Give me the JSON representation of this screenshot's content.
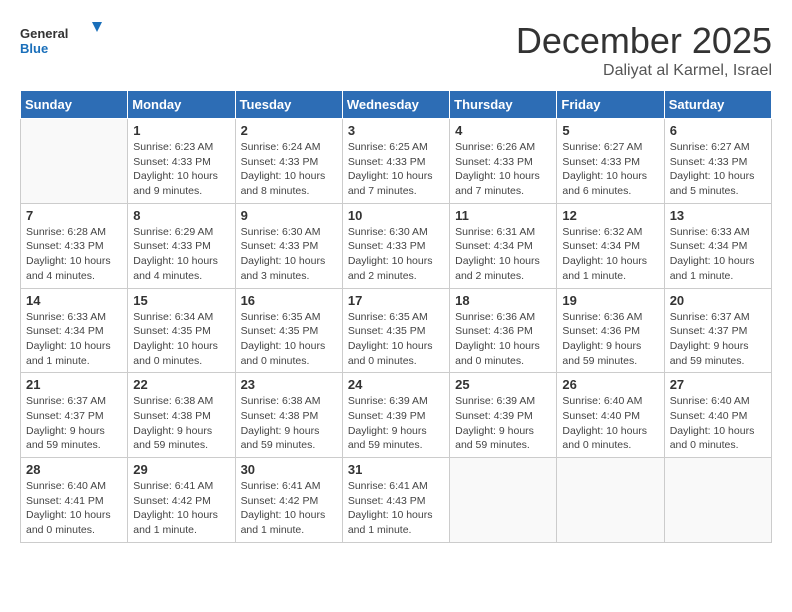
{
  "header": {
    "logo_general": "General",
    "logo_blue": "Blue",
    "month_title": "December 2025",
    "subtitle": "Daliyat al Karmel, Israel"
  },
  "calendar": {
    "days_of_week": [
      "Sunday",
      "Monday",
      "Tuesday",
      "Wednesday",
      "Thursday",
      "Friday",
      "Saturday"
    ],
    "weeks": [
      [
        {
          "day": "",
          "info": ""
        },
        {
          "day": "1",
          "info": "Sunrise: 6:23 AM\nSunset: 4:33 PM\nDaylight: 10 hours\nand 9 minutes."
        },
        {
          "day": "2",
          "info": "Sunrise: 6:24 AM\nSunset: 4:33 PM\nDaylight: 10 hours\nand 8 minutes."
        },
        {
          "day": "3",
          "info": "Sunrise: 6:25 AM\nSunset: 4:33 PM\nDaylight: 10 hours\nand 7 minutes."
        },
        {
          "day": "4",
          "info": "Sunrise: 6:26 AM\nSunset: 4:33 PM\nDaylight: 10 hours\nand 7 minutes."
        },
        {
          "day": "5",
          "info": "Sunrise: 6:27 AM\nSunset: 4:33 PM\nDaylight: 10 hours\nand 6 minutes."
        },
        {
          "day": "6",
          "info": "Sunrise: 6:27 AM\nSunset: 4:33 PM\nDaylight: 10 hours\nand 5 minutes."
        }
      ],
      [
        {
          "day": "7",
          "info": "Sunrise: 6:28 AM\nSunset: 4:33 PM\nDaylight: 10 hours\nand 4 minutes."
        },
        {
          "day": "8",
          "info": "Sunrise: 6:29 AM\nSunset: 4:33 PM\nDaylight: 10 hours\nand 4 minutes."
        },
        {
          "day": "9",
          "info": "Sunrise: 6:30 AM\nSunset: 4:33 PM\nDaylight: 10 hours\nand 3 minutes."
        },
        {
          "day": "10",
          "info": "Sunrise: 6:30 AM\nSunset: 4:33 PM\nDaylight: 10 hours\nand 2 minutes."
        },
        {
          "day": "11",
          "info": "Sunrise: 6:31 AM\nSunset: 4:34 PM\nDaylight: 10 hours\nand 2 minutes."
        },
        {
          "day": "12",
          "info": "Sunrise: 6:32 AM\nSunset: 4:34 PM\nDaylight: 10 hours\nand 1 minute."
        },
        {
          "day": "13",
          "info": "Sunrise: 6:33 AM\nSunset: 4:34 PM\nDaylight: 10 hours\nand 1 minute."
        }
      ],
      [
        {
          "day": "14",
          "info": "Sunrise: 6:33 AM\nSunset: 4:34 PM\nDaylight: 10 hours\nand 1 minute."
        },
        {
          "day": "15",
          "info": "Sunrise: 6:34 AM\nSunset: 4:35 PM\nDaylight: 10 hours\nand 0 minutes."
        },
        {
          "day": "16",
          "info": "Sunrise: 6:35 AM\nSunset: 4:35 PM\nDaylight: 10 hours\nand 0 minutes."
        },
        {
          "day": "17",
          "info": "Sunrise: 6:35 AM\nSunset: 4:35 PM\nDaylight: 10 hours\nand 0 minutes."
        },
        {
          "day": "18",
          "info": "Sunrise: 6:36 AM\nSunset: 4:36 PM\nDaylight: 10 hours\nand 0 minutes."
        },
        {
          "day": "19",
          "info": "Sunrise: 6:36 AM\nSunset: 4:36 PM\nDaylight: 9 hours\nand 59 minutes."
        },
        {
          "day": "20",
          "info": "Sunrise: 6:37 AM\nSunset: 4:37 PM\nDaylight: 9 hours\nand 59 minutes."
        }
      ],
      [
        {
          "day": "21",
          "info": "Sunrise: 6:37 AM\nSunset: 4:37 PM\nDaylight: 9 hours\nand 59 minutes."
        },
        {
          "day": "22",
          "info": "Sunrise: 6:38 AM\nSunset: 4:38 PM\nDaylight: 9 hours\nand 59 minutes."
        },
        {
          "day": "23",
          "info": "Sunrise: 6:38 AM\nSunset: 4:38 PM\nDaylight: 9 hours\nand 59 minutes."
        },
        {
          "day": "24",
          "info": "Sunrise: 6:39 AM\nSunset: 4:39 PM\nDaylight: 9 hours\nand 59 minutes."
        },
        {
          "day": "25",
          "info": "Sunrise: 6:39 AM\nSunset: 4:39 PM\nDaylight: 9 hours\nand 59 minutes."
        },
        {
          "day": "26",
          "info": "Sunrise: 6:40 AM\nSunset: 4:40 PM\nDaylight: 10 hours\nand 0 minutes."
        },
        {
          "day": "27",
          "info": "Sunrise: 6:40 AM\nSunset: 4:40 PM\nDaylight: 10 hours\nand 0 minutes."
        }
      ],
      [
        {
          "day": "28",
          "info": "Sunrise: 6:40 AM\nSunset: 4:41 PM\nDaylight: 10 hours\nand 0 minutes."
        },
        {
          "day": "29",
          "info": "Sunrise: 6:41 AM\nSunset: 4:42 PM\nDaylight: 10 hours\nand 1 minute."
        },
        {
          "day": "30",
          "info": "Sunrise: 6:41 AM\nSunset: 4:42 PM\nDaylight: 10 hours\nand 1 minute."
        },
        {
          "day": "31",
          "info": "Sunrise: 6:41 AM\nSunset: 4:43 PM\nDaylight: 10 hours\nand 1 minute."
        },
        {
          "day": "",
          "info": ""
        },
        {
          "day": "",
          "info": ""
        },
        {
          "day": "",
          "info": ""
        }
      ]
    ]
  }
}
